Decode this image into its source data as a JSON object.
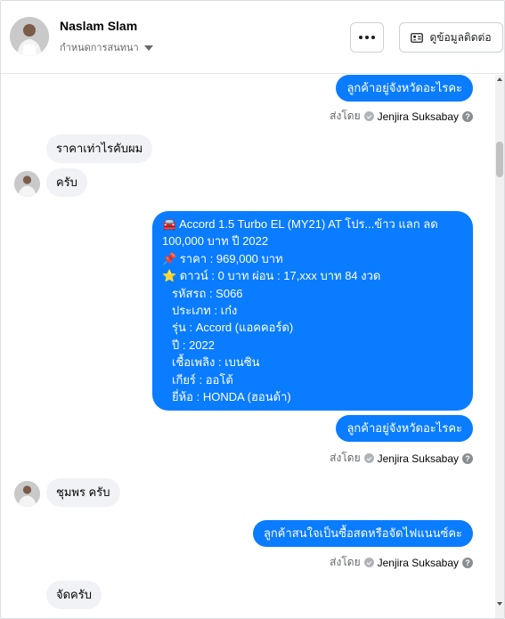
{
  "header": {
    "contact_name": "Naslam Slam",
    "status_text": "กำหนดการสนทนา",
    "more_icon": "more-horizontal-icon",
    "info_button_label": "ดูข้อมูลติดต่อ",
    "info_icon": "contact-card-icon"
  },
  "messages": [
    {
      "type": "outgoing",
      "text": "ลูกค้าอยู่จังหวัดอะไรคะ"
    },
    {
      "type": "sender",
      "prefix": "ส่งโดย",
      "name": "Jenjira Suksabay"
    },
    {
      "type": "incoming",
      "text": "ราคาเท่าไรคับผม"
    },
    {
      "type": "incoming",
      "text": "ครับ"
    },
    {
      "type": "outgoing-detail",
      "lines": [
        "🚘 Accord 1.5 Turbo EL (MY21) AT โปร...ข้าว แลก ลด",
        "100,000 บาท ปี 2022",
        "📌 ราคา : 969,000 บาท",
        "⭐ ดาวน์ : 0 บาท ผ่อน : 17,xxx บาท 84 งวด",
        "รหัสรถ : S066",
        "ประเภท : เก๋ง",
        "รุ่น : Accord (แอคคอร์ด)",
        "ปี : 2022",
        "เชื้อเพลิง : เบนซิน",
        "เกียร์ : ออโต้",
        "ยี่ห้อ : HONDA (ฮอนด้า)"
      ]
    },
    {
      "type": "outgoing",
      "text": "ลูกค้าอยู่จังหวัดอะไรคะ"
    },
    {
      "type": "sender",
      "prefix": "ส่งโดย",
      "name": "Jenjira Suksabay"
    },
    {
      "type": "incoming",
      "text": "ชุมพร ครับ"
    },
    {
      "type": "outgoing",
      "text": "ลูกค้าสนใจเป็นซื้อสดหรือจัดไฟแนนซ์คะ"
    },
    {
      "type": "sender",
      "prefix": "ส่งโดย",
      "name": "Jenjira Suksabay"
    },
    {
      "type": "incoming",
      "text": "จัดครับ"
    }
  ],
  "icons": {
    "verified": "check-circle-icon",
    "help": "help-circle-icon",
    "help_glyph": "?"
  },
  "colors": {
    "accent": "#0a7cff",
    "incoming_bubble": "#f0f2f5",
    "meta_text": "#65676b"
  }
}
